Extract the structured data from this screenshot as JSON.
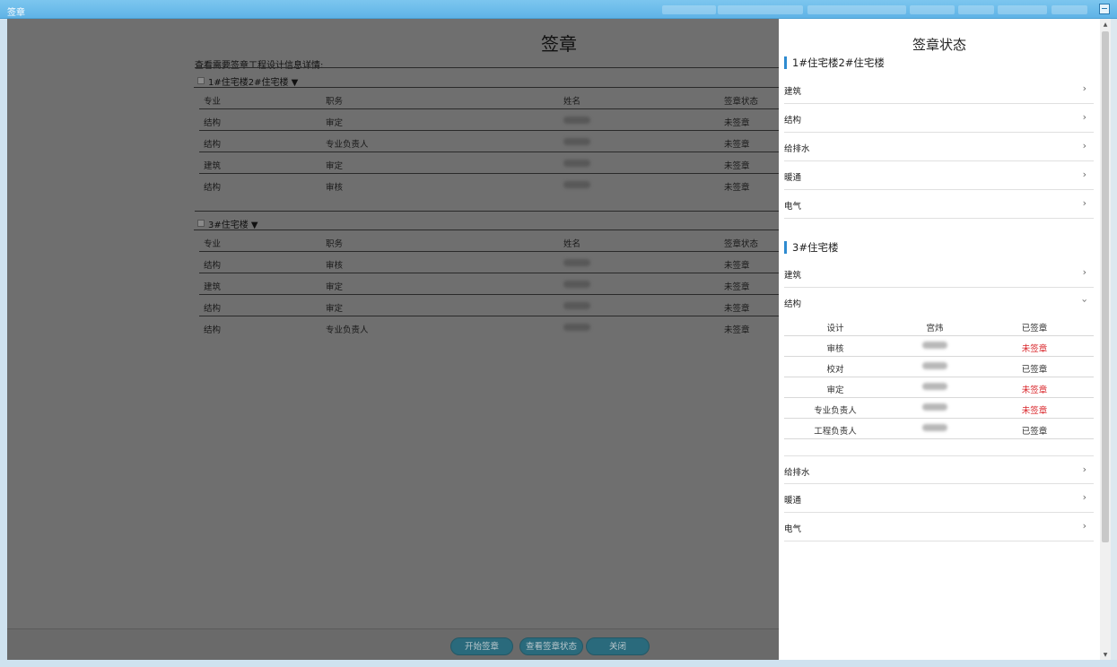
{
  "window": {
    "title": "签章"
  },
  "main": {
    "title": "签章",
    "caption": "查看需要签章工程设计信息详情:",
    "columns": [
      "专业",
      "职务",
      "姓名",
      "签章状态"
    ],
    "groups": [
      {
        "name": "1#住宅楼2#住宅楼 ▼",
        "rows": [
          {
            "major": "结构",
            "role": "审定",
            "status": "未签章"
          },
          {
            "major": "结构",
            "role": "专业负责人",
            "status": "未签章"
          },
          {
            "major": "建筑",
            "role": "审定",
            "status": "未签章"
          },
          {
            "major": "结构",
            "role": "审核",
            "status": "未签章"
          }
        ]
      },
      {
        "name": "3#住宅楼 ▼",
        "rows": [
          {
            "major": "结构",
            "role": "审核",
            "status": "未签章"
          },
          {
            "major": "建筑",
            "role": "审定",
            "status": "未签章"
          },
          {
            "major": "结构",
            "role": "审定",
            "status": "未签章"
          },
          {
            "major": "结构",
            "role": "专业负责人",
            "status": "未签章"
          }
        ]
      }
    ],
    "buttons": {
      "start": "开始签章",
      "view_status": "查看签章状态",
      "close": "关闭"
    }
  },
  "panel": {
    "title": "签章状态",
    "section1": {
      "title": "1#住宅楼2#住宅楼",
      "items": [
        "建筑",
        "结构",
        "给排水",
        "暖通",
        "电气"
      ]
    },
    "section2": {
      "title": "3#住宅楼",
      "items_before": [
        "建筑"
      ],
      "expanded": {
        "label": "结构",
        "header": [
          "设计",
          "宫炜",
          "已签章"
        ],
        "rows": [
          {
            "role": "审核",
            "status": "未签章",
            "signed": false
          },
          {
            "role": "校对",
            "status": "已签章",
            "signed": true
          },
          {
            "role": "审定",
            "status": "未签章",
            "signed": false
          },
          {
            "role": "专业负责人",
            "status": "未签章",
            "signed": false
          },
          {
            "role": "工程负责人",
            "status": "已签章",
            "signed": true
          }
        ]
      },
      "items_after": [
        "给排水",
        "暖通",
        "电气"
      ]
    },
    "colors": {
      "accent": "#2e8bd0",
      "unsigned": "#d9252a"
    }
  }
}
